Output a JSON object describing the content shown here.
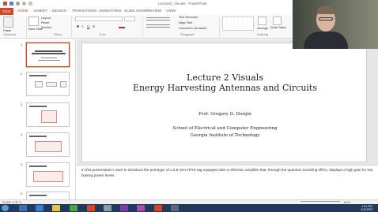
{
  "window": {
    "title": "Lecture2_Visuals - PowerPoint"
  },
  "tabs": [
    {
      "label": "FILE"
    },
    {
      "label": "HOME"
    },
    {
      "label": "INSERT"
    },
    {
      "label": "DESIGN"
    },
    {
      "label": "TRANSITIONS"
    },
    {
      "label": "ANIMATIONS"
    },
    {
      "label": "SLIDE SHOW"
    },
    {
      "label": "REVIEW"
    },
    {
      "label": "VIEW"
    }
  ],
  "ribbon": {
    "clipboard": {
      "label": "Clipboard",
      "paste": "Paste"
    },
    "slides": {
      "label": "Slides",
      "new_slide": "New Slide",
      "layout": "Layout",
      "reset": "Reset",
      "section": "Section"
    },
    "font": {
      "label": "Font"
    },
    "paragraph": {
      "label": "Paragraph",
      "text_direction": "Text Direction",
      "align_text": "Align Text",
      "smartart": "Convert to SmartArt"
    },
    "drawing": {
      "label": "Drawing",
      "arrange": "Arrange",
      "quick_styles": "Quick Styles"
    }
  },
  "thumbnails": [
    {
      "num": "1"
    },
    {
      "num": "2"
    },
    {
      "num": "3"
    },
    {
      "num": "4"
    },
    {
      "num": "5"
    },
    {
      "num": "6"
    }
  ],
  "slide": {
    "title_line1": "Lecture 2 Visuals",
    "title_line2": "Energy Harvesting Antennas and Circuits",
    "author": "Prof. Gregory D. Durgin",
    "affil_line1": "School of Electrical and Computer Engineering",
    "affil_line2": "Georgia Institute of Technology"
  },
  "notes": {
    "text": "In this presentation I want to introduce the prototype of a 5.8 GHz RFID tag equipped with a reflection amplifier that, through the quantum tunneling effect, displays a high gain for low biasing power levels."
  },
  "status": {
    "slide": "SLIDE 1 OF 9",
    "zoom": "64%"
  },
  "taskbar": {
    "time": "1:01 PM",
    "date": "1/11/2017"
  },
  "colors": {
    "accent": "#d24726",
    "taskbar": "#1f3a5c"
  }
}
